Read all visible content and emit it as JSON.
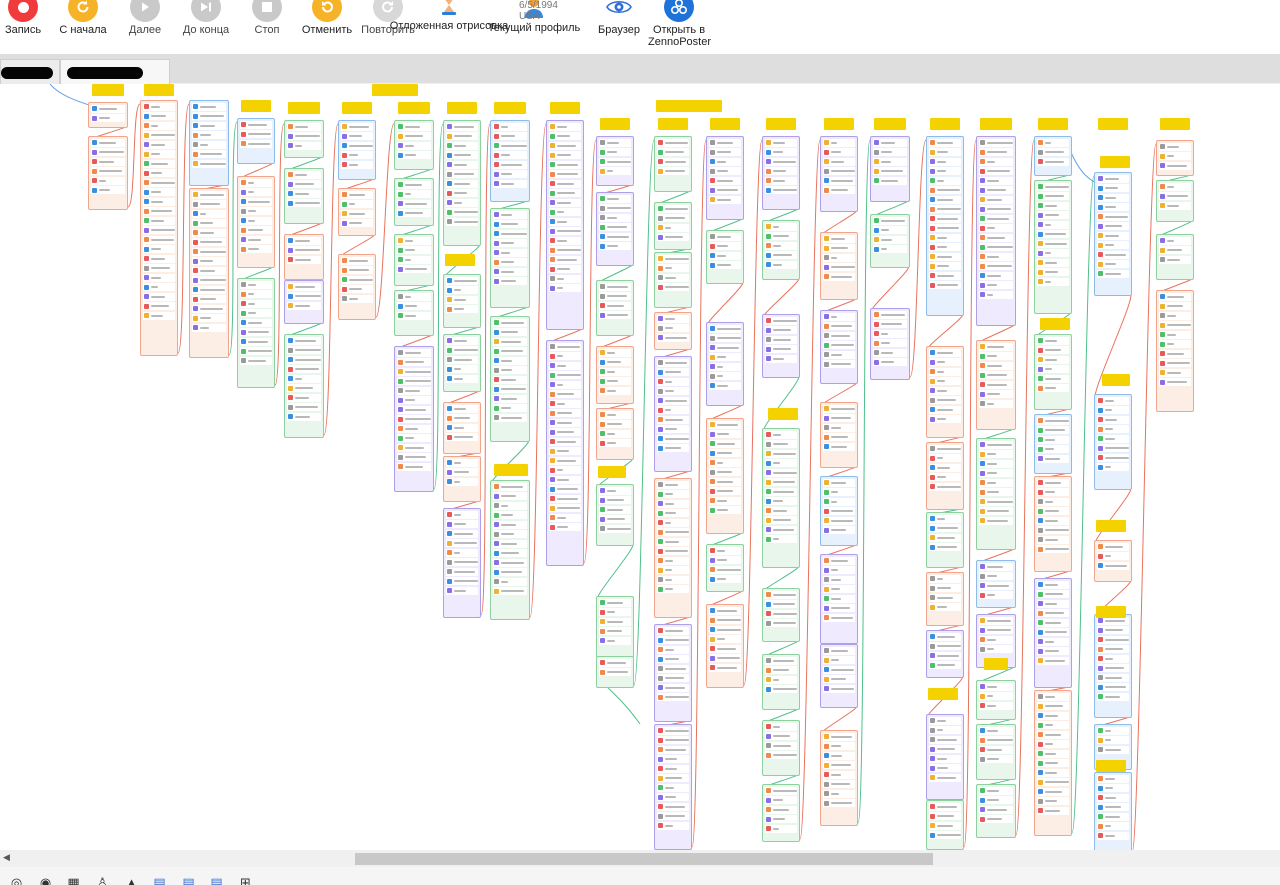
{
  "toolbar": {
    "buttons": [
      {
        "id": "record",
        "label": "Запись",
        "icon": "record-icon",
        "color": "#ef3b3b",
        "enabled": true
      },
      {
        "id": "restart",
        "label": "С начала",
        "icon": "restart-icon",
        "color": "#f6b328",
        "enabled": true
      },
      {
        "id": "next",
        "label": "Далее",
        "icon": "play-icon",
        "color": "#c9c9c9",
        "enabled": false
      },
      {
        "id": "to-end",
        "label": "До конца",
        "icon": "skip-to-end-icon",
        "color": "#c9c9c9",
        "enabled": false
      },
      {
        "id": "stop",
        "label": "Стоп",
        "icon": "stop-icon",
        "color": "#c9c9c9",
        "enabled": false
      },
      {
        "id": "undo",
        "label": "Отменить",
        "icon": "undo-icon",
        "color": "#f6b328",
        "enabled": true
      },
      {
        "id": "redo",
        "label": "Повторить",
        "icon": "redo-icon",
        "color": "#d8d8d8",
        "enabled": false
      },
      {
        "id": "deferred",
        "label": "Отложенная отрисовка",
        "icon": "hourglass-icon",
        "color": "#e0a066",
        "enabled": true
      },
      {
        "id": "profile",
        "label": "Текущий профиль",
        "icon": "user-profile-icon",
        "color": "#f0a23a",
        "enabled": true
      },
      {
        "id": "browser",
        "label": "Браузер",
        "icon": "eye-icon",
        "color": "#2f6fd6",
        "enabled": true
      },
      {
        "id": "open-zp",
        "label": "Открыть в ZennoPoster",
        "icon": "zennoposter-icon",
        "color": "#1e73d8",
        "enabled": true
      }
    ],
    "profile": {
      "birthdate": "6/5/1994",
      "country": "USA"
    }
  },
  "colors": {
    "accent": "#f4d200",
    "wire_red": "#e9725c",
    "wire_green": "#4fc08a",
    "wire_blue": "#6aa0e0"
  },
  "bottom_icons": [
    "camera-icon",
    "target-icon",
    "grid-icon",
    "person-icon",
    "lock-icon",
    "document-icon",
    "document-list-icon",
    "document-list-icon",
    "add-box-icon"
  ]
}
